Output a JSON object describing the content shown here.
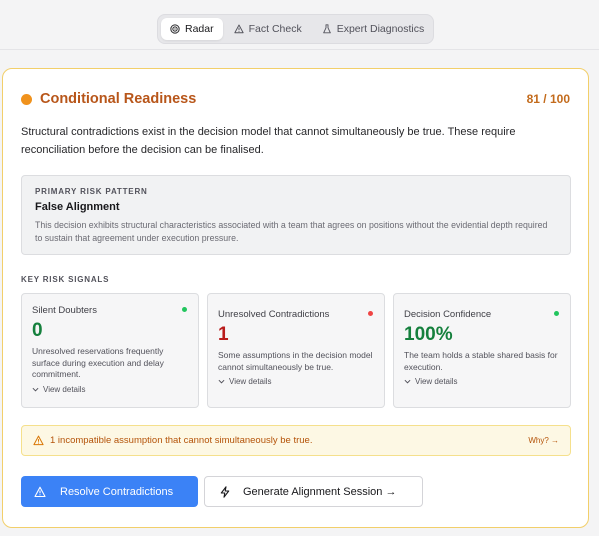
{
  "tabs": [
    {
      "label": "Radar",
      "icon": "radar-icon",
      "active": true
    },
    {
      "label": "Fact Check",
      "icon": "warning-icon",
      "active": false
    },
    {
      "label": "Expert Diagnostics",
      "icon": "flask-icon",
      "active": false
    }
  ],
  "status": {
    "title": "Conditional Readiness",
    "score": "81 / 100",
    "color": "#f0921c"
  },
  "description": "Structural contradictions exist in the decision model that cannot simultaneously be true. These require reconciliation before the decision can be finalised.",
  "risk_pattern": {
    "label": "PRIMARY RISK PATTERN",
    "title": "False Alignment",
    "description": "This decision exhibits structural characteristics associated with a team that agrees on positions without the evidential depth required to sustain that agreement under execution pressure."
  },
  "signals_label": "KEY RISK SIGNALS",
  "signals": [
    {
      "name": "Silent Doubters",
      "value": "0",
      "value_color": "#15803d",
      "dot_color": "#22c55e",
      "description": "Unresolved reservations frequently surface during execution and delay commitment.",
      "link": "View details"
    },
    {
      "name": "Unresolved Contradictions",
      "value": "1",
      "value_color": "#b91c1c",
      "dot_color": "#ef4444",
      "description": "Some assumptions in the decision model cannot simultaneously be true.",
      "link": "View details"
    },
    {
      "name": "Decision Confidence",
      "value": "100%",
      "value_color": "#15803d",
      "dot_color": "#22c55e",
      "description": "The team holds a stable shared basis for execution.",
      "link": "View details"
    }
  ],
  "warning": {
    "text": "1 incompatible assumption that cannot simultaneously be true.",
    "link": "Why? →"
  },
  "actions": {
    "primary": "Resolve Contradictions",
    "secondary": "Generate Alignment Session →"
  }
}
